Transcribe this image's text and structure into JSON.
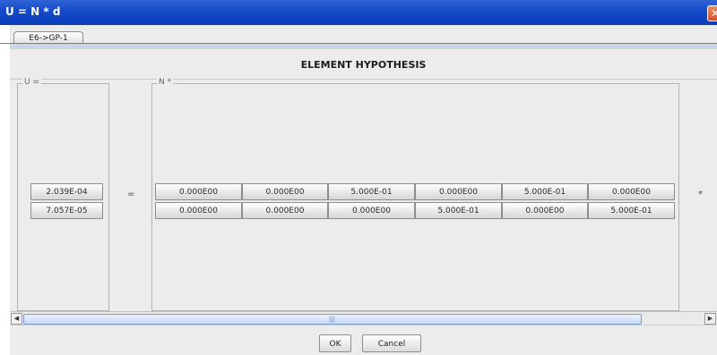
{
  "window": {
    "title": "U = N * d",
    "close_icon": "close-icon"
  },
  "tabs": [
    {
      "label": "E6->GP-1"
    }
  ],
  "main": {
    "heading": "ELEMENT HYPOTHESIS",
    "u_group_label": "U =",
    "n_group_label": "N *",
    "equals_sign": "=",
    "multiply_sign": "*",
    "u_values": [
      "2.039E-04",
      "7.057E-05"
    ],
    "n_matrix": [
      [
        "0.000E00",
        "0.000E00",
        "5.000E-01",
        "0.000E00",
        "5.000E-01",
        "0.000E00"
      ],
      [
        "0.000E00",
        "0.000E00",
        "0.000E00",
        "5.000E-01",
        "0.000E00",
        "5.000E-01"
      ]
    ]
  },
  "scrollbar": {
    "left_arrow": "◀",
    "right_arrow": "▶",
    "grip": "|||"
  },
  "footer": {
    "ok_label": "OK",
    "cancel_label": "Cancel"
  },
  "colors": {
    "titlebar": "#1449c8",
    "panel": "#ececec",
    "scroll_thumb": "#c7daf6"
  }
}
